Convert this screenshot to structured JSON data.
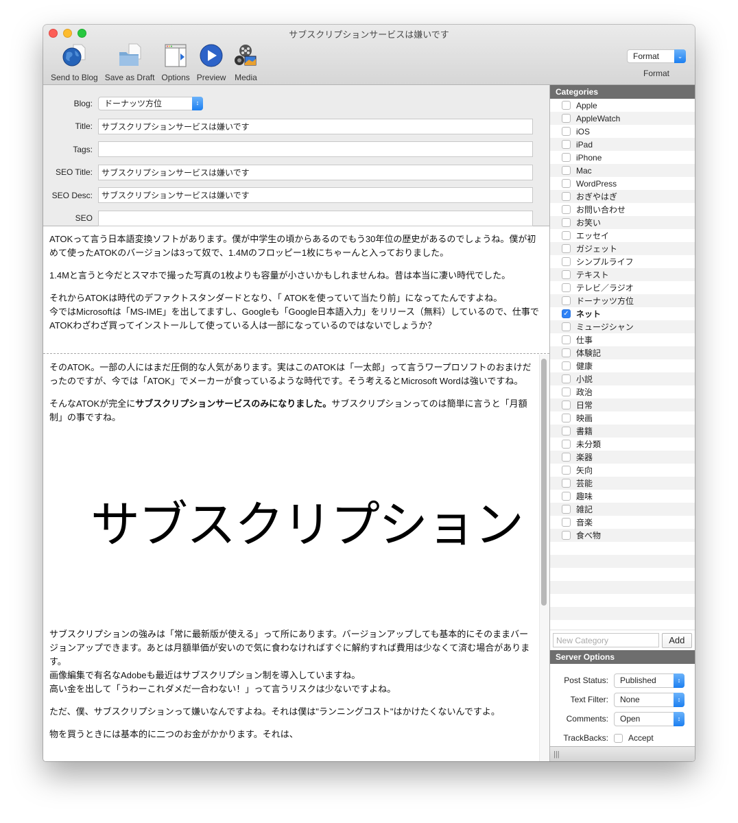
{
  "window": {
    "title": "サブスクリプションサービスは嫌いです"
  },
  "toolbar": {
    "items": [
      {
        "label": "Send to Blog",
        "icon": "globe-send-icon"
      },
      {
        "label": "Save as Draft",
        "icon": "folder-draft-icon"
      },
      {
        "label": "Options",
        "icon": "options-panel-icon"
      },
      {
        "label": "Preview",
        "icon": "play-icon"
      },
      {
        "label": "Media",
        "icon": "media-film-icon"
      }
    ],
    "format_select_value": "Format",
    "format_label": "Format"
  },
  "fields": {
    "blog_label": "Blog:",
    "blog_value": "ドーナッツ方位",
    "title_label": "Title:",
    "title_value": "サブスクリプションサービスは嫌いです",
    "tags_label": "Tags:",
    "tags_value": "",
    "seo_title_label": "SEO Title:",
    "seo_title_value": "サブスクリプションサービスは嫌いです",
    "seo_desc_label": "SEO Desc:",
    "seo_desc_value": "サブスクリプションサービスは嫌いです",
    "seo_label": "SEO",
    "seo_value": ""
  },
  "editor": {
    "top_paragraphs": [
      "ATOKって言う日本語変換ソフトがあります。僕が中学生の頃からあるのでもう30年位の歴史があるのでしょうね。僕が初めて使ったATOKのバージョンは3って奴で、1.4Mのフロッピー1枚にちゃーんと入っておりました。",
      "1.4Mと言うと今だとスマホで撮った写真の1枚よりも容量が小さいかもしれませんね。昔は本当に凄い時代でした。",
      "それからATOKは時代のデファクトスタンダードとなり、「 ATOKを使っていて当たり前」になってたんですよね。\n今ではMicrosoftは「MS-IME」を出してますし、Googleも「Google日本語入力」をリリース（無料）しているので、仕事でATOKわざわざ買ってインストールして使っている人は一部になっているのではないでしょうか？"
    ],
    "bottom_para1": "そのATOK。一部の人にはまだ圧倒的な人気があります。実はこのATOKは「一太郎」って言うワープロソフトのおまけだったのですが、今では「ATOK」でメーカーが食っているような時代です。そう考えるとMicrosoft Wordは強いですね。",
    "bottom_para2_pre": "そんなATOKが完全に",
    "bottom_para2_bold": "サブスクリプションサービスのみになりました。",
    "bottom_para2_post": "サブスクリプションってのは簡単に言うと「月額制」の事ですね。",
    "image_text": "サブスクリプション",
    "bottom_para3": "サブスクリプションの強みは「常に最新版が使える」って所にあります。バージョンアップしても基本的にそのままバージョンアップできます。あとは月額単価が安いので気に食わなければすぐに解約すれば費用は少なくて済む場合があります。\n画像編集で有名なAdobeも最近はサブスクリプション制を導入していますね。\n高い金を出して「うわーこれダメだ一合わない！」って言うリスクは少ないですよね。",
    "bottom_para4": "ただ、僕、サブスクリプションって嫌いなんですよね。それは僕は\"ランニングコスト\"はかけたくないんですよ。",
    "bottom_para5": "物を買うときには基本的に二つのお金がかかります。それは、"
  },
  "categories": {
    "header": "Categories",
    "items": [
      {
        "name": "Apple",
        "checked": false
      },
      {
        "name": "AppleWatch",
        "checked": false
      },
      {
        "name": "iOS",
        "checked": false
      },
      {
        "name": "iPad",
        "checked": false
      },
      {
        "name": "iPhone",
        "checked": false
      },
      {
        "name": "Mac",
        "checked": false
      },
      {
        "name": "WordPress",
        "checked": false
      },
      {
        "name": "おぎやはぎ",
        "checked": false
      },
      {
        "name": "お問い合わせ",
        "checked": false
      },
      {
        "name": "お笑い",
        "checked": false
      },
      {
        "name": "エッセイ",
        "checked": false
      },
      {
        "name": "ガジェット",
        "checked": false
      },
      {
        "name": "シンプルライフ",
        "checked": false
      },
      {
        "name": "テキスト",
        "checked": false
      },
      {
        "name": "テレビ／ラジオ",
        "checked": false
      },
      {
        "name": "ドーナッツ方位",
        "checked": false
      },
      {
        "name": "ネット",
        "checked": true
      },
      {
        "name": "ミュージシャン",
        "checked": false
      },
      {
        "name": "仕事",
        "checked": false
      },
      {
        "name": "体験記",
        "checked": false
      },
      {
        "name": "健康",
        "checked": false
      },
      {
        "name": "小説",
        "checked": false
      },
      {
        "name": "政治",
        "checked": false
      },
      {
        "name": "日常",
        "checked": false
      },
      {
        "name": "映画",
        "checked": false
      },
      {
        "name": "書籍",
        "checked": false
      },
      {
        "name": "未分類",
        "checked": false
      },
      {
        "name": "楽器",
        "checked": false
      },
      {
        "name": "矢向",
        "checked": false
      },
      {
        "name": "芸能",
        "checked": false
      },
      {
        "name": "趣味",
        "checked": false
      },
      {
        "name": "雑記",
        "checked": false
      },
      {
        "name": "音楽",
        "checked": false
      },
      {
        "name": "食べ物",
        "checked": false
      }
    ],
    "new_category_placeholder": "New Category",
    "add_label": "Add"
  },
  "server_options": {
    "header": "Server Options",
    "post_status_label": "Post Status:",
    "post_status_value": "Published",
    "text_filter_label": "Text Filter:",
    "text_filter_value": "None",
    "comments_label": "Comments:",
    "comments_value": "Open",
    "trackbacks_label": "TrackBacks:",
    "trackbacks_option": "Accept",
    "trackbacks_checked": false
  },
  "status_bar": {
    "resize_handle": "|||"
  }
}
